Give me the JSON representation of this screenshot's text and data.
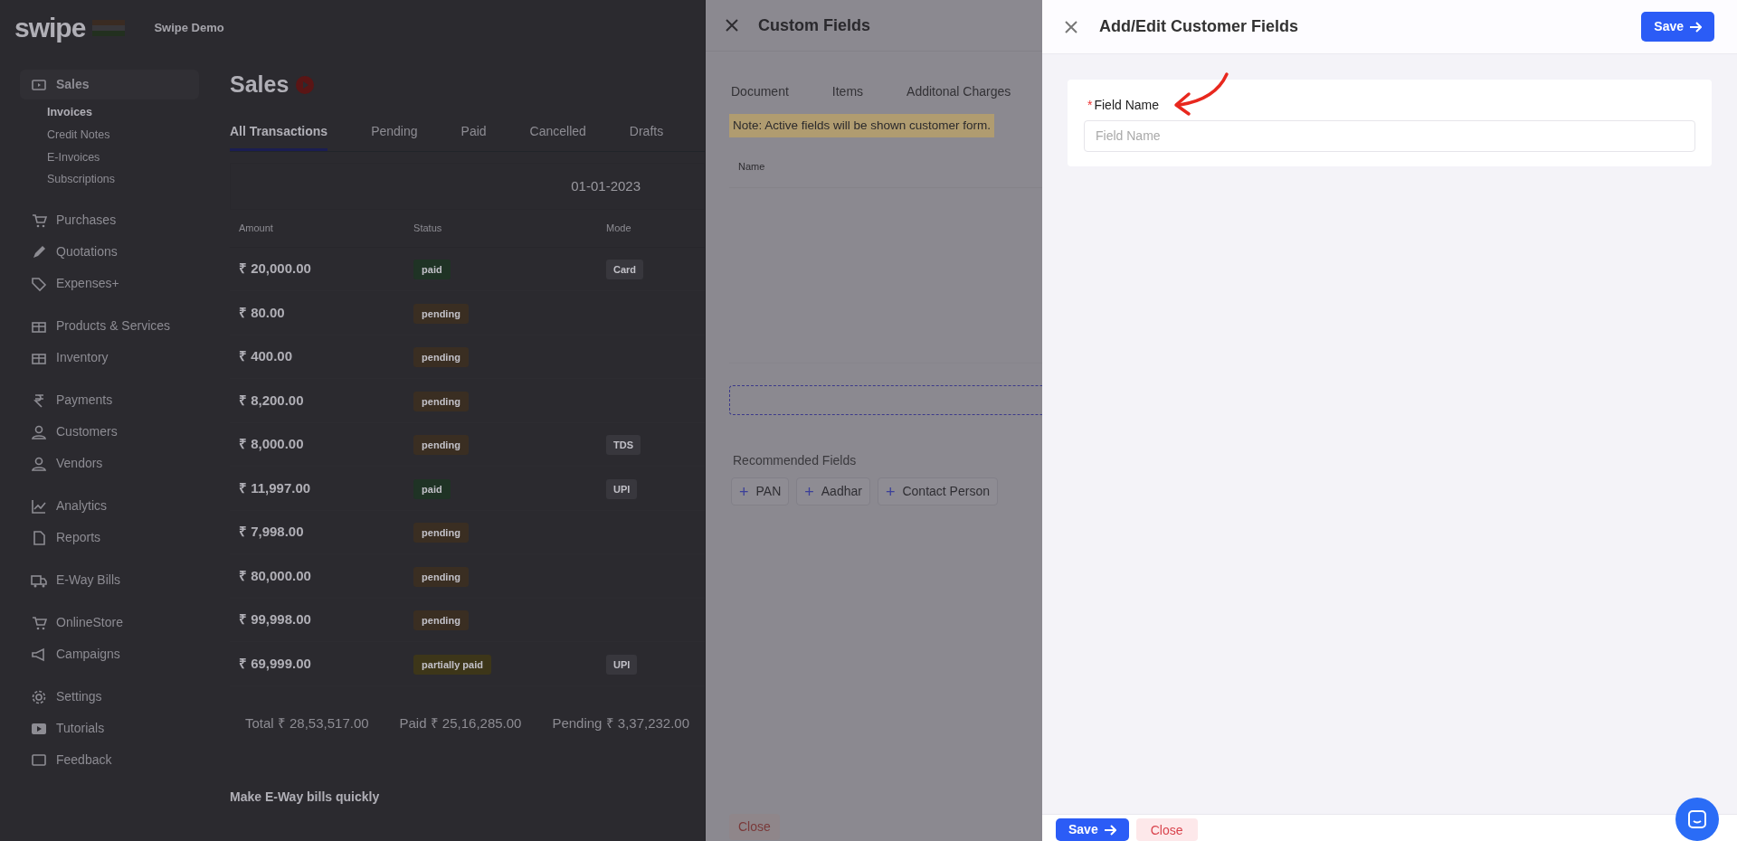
{
  "sidebar": {
    "logo": "swipe",
    "account": "Swipe Demo",
    "items": [
      {
        "label": "Sales",
        "selected": true,
        "children": [
          {
            "label": "Invoices",
            "selected": true
          },
          {
            "label": "Credit Notes",
            "selected": false
          },
          {
            "label": "E-Invoices",
            "selected": false
          },
          {
            "label": "Subscriptions",
            "selected": false
          }
        ]
      },
      {
        "label": "Purchases",
        "selected": false
      },
      {
        "label": "Quotations",
        "selected": false
      },
      {
        "label": "Expenses+",
        "selected": false
      },
      {
        "label": "Products & Services",
        "selected": false
      },
      {
        "label": "Inventory",
        "selected": false
      },
      {
        "label": "Payments",
        "selected": false
      },
      {
        "label": "Customers",
        "selected": false
      },
      {
        "label": "Vendors",
        "selected": false
      },
      {
        "label": "Analytics",
        "selected": false
      },
      {
        "label": "Reports",
        "selected": false
      },
      {
        "label": "E-Way Bills",
        "selected": false
      },
      {
        "label": "OnlineStore",
        "selected": false
      },
      {
        "label": "Campaigns",
        "selected": false
      },
      {
        "label": "Settings",
        "selected": false
      },
      {
        "label": "Tutorials",
        "selected": false
      },
      {
        "label": "Feedback",
        "selected": false
      }
    ]
  },
  "sales": {
    "title": "Sales",
    "tabs": [
      {
        "label": "All Transactions",
        "selected": true
      },
      {
        "label": "Pending",
        "selected": false
      },
      {
        "label": "Paid",
        "selected": false
      },
      {
        "label": "Cancelled",
        "selected": false
      },
      {
        "label": "Drafts",
        "selected": false
      }
    ],
    "date": "01-01-2023",
    "columns": [
      "Amount",
      "Status",
      "Mode"
    ],
    "rows": [
      {
        "amount": "₹ 20,000.00",
        "status": "paid",
        "kind": "paid",
        "mode": "Card"
      },
      {
        "amount": "₹ 80.00",
        "status": "pending",
        "kind": "pending"
      },
      {
        "amount": "₹ 400.00",
        "status": "pending",
        "kind": "pending"
      },
      {
        "amount": "₹ 8,200.00",
        "status": "pending",
        "kind": "pending"
      },
      {
        "amount": "₹ 8,000.00",
        "status": "pending",
        "kind": "pending",
        "mode": "TDS"
      },
      {
        "amount": "₹ 11,997.00",
        "status": "paid",
        "kind": "paid",
        "mode": "UPI"
      },
      {
        "amount": "₹ 7,998.00",
        "status": "pending",
        "kind": "pending"
      },
      {
        "amount": "₹ 80,000.00",
        "status": "pending",
        "kind": "pending"
      },
      {
        "amount": "₹ 99,998.00",
        "status": "pending",
        "kind": "pending"
      },
      {
        "amount": "₹ 69,999.00",
        "status": "partially paid",
        "kind": "partial",
        "mode": "UPI"
      }
    ],
    "totals": [
      {
        "label": "Total",
        "value": "₹ 28,53,517.00"
      },
      {
        "label": "Paid",
        "value": "₹ 25,16,285.00"
      },
      {
        "label": "Pending",
        "value": "₹ 3,37,232.00"
      }
    ],
    "promo": "Make E-Way bills quickly"
  },
  "custom_fields": {
    "title": "Custom Fields",
    "tabs": [
      {
        "label": "Document",
        "selected": false
      },
      {
        "label": "Items",
        "selected": false
      },
      {
        "label": "Additonal Charges",
        "selected": false
      }
    ],
    "note": "Note: Active fields will be shown customer form.",
    "column": "Name",
    "recommended_label": "Recommended Fields",
    "recommended": [
      {
        "icon": "+",
        "label": "PAN"
      },
      {
        "icon": "+",
        "label": "Aadhar"
      },
      {
        "icon": "+",
        "label": "Contact Person"
      }
    ],
    "close": "Close"
  },
  "editor": {
    "title": "Add/Edit Customer Fields",
    "save": "Save",
    "field": {
      "required_mark": "*",
      "label": "Field Name",
      "placeholder": "Field Name"
    },
    "footer": [
      {
        "label": "Save",
        "kind": "primary"
      },
      {
        "label": "Close",
        "kind": "danger"
      }
    ]
  }
}
